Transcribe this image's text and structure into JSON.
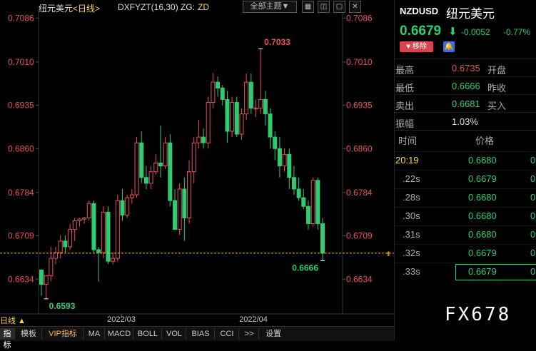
{
  "chart_header": {
    "title": "纽元美元",
    "period": "<日线>",
    "indicator": "DXFYZT(16,30)",
    "indicator_suffix": "ZG:",
    "indicator_value": "ZD",
    "theme_button": "全部主题▼",
    "icons": [
      "grid-icon",
      "split-icon",
      "fullscreen-icon",
      "close-icon"
    ]
  },
  "colors": {
    "up": "#e8505b",
    "down": "#2ecc71",
    "accent": "#ffd54a"
  },
  "chart_data": {
    "type": "candlestick",
    "symbol": "NZDUSD",
    "y_ticks": [
      "0.7086",
      "0.7010",
      "0.6935",
      "0.6860",
      "0.6784",
      "0.6709",
      "0.6634"
    ],
    "ylim": [
      0.658,
      0.71
    ],
    "x_ticks": [
      "2022/03",
      "2022/04"
    ],
    "annotations": {
      "high": "0.7033",
      "low": "0.6593",
      "last": "0.6666"
    },
    "reference_line": 0.6679,
    "candles": [
      {
        "o": 0.665,
        "h": 0.665,
        "l": 0.6605,
        "c": 0.6625
      },
      {
        "o": 0.6625,
        "h": 0.664,
        "l": 0.66,
        "c": 0.664
      },
      {
        "o": 0.664,
        "h": 0.669,
        "l": 0.663,
        "c": 0.667
      },
      {
        "o": 0.667,
        "h": 0.669,
        "l": 0.666,
        "c": 0.668
      },
      {
        "o": 0.668,
        "h": 0.671,
        "l": 0.667,
        "c": 0.67
      },
      {
        "o": 0.67,
        "h": 0.671,
        "l": 0.668,
        "c": 0.669
      },
      {
        "o": 0.669,
        "h": 0.673,
        "l": 0.6685,
        "c": 0.672
      },
      {
        "o": 0.672,
        "h": 0.674,
        "l": 0.67,
        "c": 0.6735
      },
      {
        "o": 0.6735,
        "h": 0.674,
        "l": 0.6725,
        "c": 0.6738
      },
      {
        "o": 0.6738,
        "h": 0.6742,
        "l": 0.673,
        "c": 0.674
      },
      {
        "o": 0.674,
        "h": 0.677,
        "l": 0.6735,
        "c": 0.6765
      },
      {
        "o": 0.6765,
        "h": 0.677,
        "l": 0.668,
        "c": 0.6685
      },
      {
        "o": 0.6685,
        "h": 0.669,
        "l": 0.663,
        "c": 0.668
      },
      {
        "o": 0.668,
        "h": 0.676,
        "l": 0.667,
        "c": 0.675
      },
      {
        "o": 0.675,
        "h": 0.676,
        "l": 0.666,
        "c": 0.6665
      },
      {
        "o": 0.6665,
        "h": 0.668,
        "l": 0.666,
        "c": 0.667
      },
      {
        "o": 0.667,
        "h": 0.678,
        "l": 0.6665,
        "c": 0.677
      },
      {
        "o": 0.677,
        "h": 0.679,
        "l": 0.6735,
        "c": 0.6745
      },
      {
        "o": 0.6745,
        "h": 0.678,
        "l": 0.674,
        "c": 0.6775
      },
      {
        "o": 0.6775,
        "h": 0.679,
        "l": 0.6765,
        "c": 0.678
      },
      {
        "o": 0.678,
        "h": 0.688,
        "l": 0.6775,
        "c": 0.687
      },
      {
        "o": 0.687,
        "h": 0.689,
        "l": 0.68,
        "c": 0.681
      },
      {
        "o": 0.681,
        "h": 0.683,
        "l": 0.679,
        "c": 0.68
      },
      {
        "o": 0.68,
        "h": 0.683,
        "l": 0.679,
        "c": 0.682
      },
      {
        "o": 0.682,
        "h": 0.685,
        "l": 0.6815,
        "c": 0.6835
      },
      {
        "o": 0.6835,
        "h": 0.69,
        "l": 0.681,
        "c": 0.683
      },
      {
        "o": 0.683,
        "h": 0.688,
        "l": 0.6825,
        "c": 0.687
      },
      {
        "o": 0.687,
        "h": 0.6885,
        "l": 0.676,
        "c": 0.677
      },
      {
        "o": 0.677,
        "h": 0.679,
        "l": 0.672,
        "c": 0.672
      },
      {
        "o": 0.672,
        "h": 0.68,
        "l": 0.671,
        "c": 0.679
      },
      {
        "o": 0.679,
        "h": 0.681,
        "l": 0.67,
        "c": 0.674
      },
      {
        "o": 0.674,
        "h": 0.684,
        "l": 0.673,
        "c": 0.682
      },
      {
        "o": 0.682,
        "h": 0.688,
        "l": 0.68,
        "c": 0.687
      },
      {
        "o": 0.687,
        "h": 0.691,
        "l": 0.686,
        "c": 0.688
      },
      {
        "o": 0.688,
        "h": 0.6895,
        "l": 0.686,
        "c": 0.687
      },
      {
        "o": 0.687,
        "h": 0.695,
        "l": 0.686,
        "c": 0.694
      },
      {
        "o": 0.694,
        "h": 0.699,
        "l": 0.693,
        "c": 0.6975
      },
      {
        "o": 0.6975,
        "h": 0.6985,
        "l": 0.695,
        "c": 0.6965
      },
      {
        "o": 0.6965,
        "h": 0.697,
        "l": 0.6935,
        "c": 0.6945
      },
      {
        "o": 0.6945,
        "h": 0.696,
        "l": 0.687,
        "c": 0.689
      },
      {
        "o": 0.689,
        "h": 0.695,
        "l": 0.688,
        "c": 0.694
      },
      {
        "o": 0.694,
        "h": 0.695,
        "l": 0.688,
        "c": 0.6885
      },
      {
        "o": 0.6885,
        "h": 0.693,
        "l": 0.6875,
        "c": 0.692
      },
      {
        "o": 0.692,
        "h": 0.699,
        "l": 0.691,
        "c": 0.6975
      },
      {
        "o": 0.6975,
        "h": 0.699,
        "l": 0.692,
        "c": 0.693
      },
      {
        "o": 0.693,
        "h": 0.6945,
        "l": 0.6915,
        "c": 0.693
      },
      {
        "o": 0.693,
        "h": 0.7033,
        "l": 0.692,
        "c": 0.6945
      },
      {
        "o": 0.6945,
        "h": 0.696,
        "l": 0.69,
        "c": 0.692
      },
      {
        "o": 0.692,
        "h": 0.693,
        "l": 0.686,
        "c": 0.688
      },
      {
        "o": 0.688,
        "h": 0.689,
        "l": 0.684,
        "c": 0.686
      },
      {
        "o": 0.686,
        "h": 0.688,
        "l": 0.681,
        "c": 0.683
      },
      {
        "o": 0.683,
        "h": 0.686,
        "l": 0.682,
        "c": 0.685
      },
      {
        "o": 0.685,
        "h": 0.686,
        "l": 0.679,
        "c": 0.681
      },
      {
        "o": 0.681,
        "h": 0.683,
        "l": 0.678,
        "c": 0.679
      },
      {
        "o": 0.679,
        "h": 0.681,
        "l": 0.677,
        "c": 0.6775
      },
      {
        "o": 0.6775,
        "h": 0.679,
        "l": 0.6755,
        "c": 0.676
      },
      {
        "o": 0.676,
        "h": 0.677,
        "l": 0.672,
        "c": 0.673
      },
      {
        "o": 0.673,
        "h": 0.681,
        "l": 0.6725,
        "c": 0.6805
      },
      {
        "o": 0.6805,
        "h": 0.681,
        "l": 0.672,
        "c": 0.673
      },
      {
        "o": 0.673,
        "h": 0.674,
        "l": 0.6666,
        "c": 0.6679
      }
    ]
  },
  "y_axis_right": [
    "0.7086",
    "0.7010",
    "0.6935",
    "0.6860",
    "0.6784",
    "0.6709",
    "0.6634"
  ],
  "bottom_bar": {
    "period_label": "日线 ▲",
    "tabs": [
      "指标",
      "模板",
      "VIP指标",
      "MA",
      "MACD",
      "BOLL",
      "VOL",
      "BIAS",
      "CCI",
      ">>",
      "设置"
    ]
  },
  "quote": {
    "symbol": "NZDUSD",
    "name": "纽元美元",
    "price": "0.6679",
    "arrow": "⬇",
    "change": "-0.0052",
    "change_pct": "-0.77%",
    "remove_label": "移除",
    "stats": [
      {
        "k": "最高",
        "v": "0.6735",
        "k2": "开盘",
        "color": "#e8505b"
      },
      {
        "k": "最低",
        "v": "0.6666",
        "k2": "昨收",
        "color": "#2ecc71"
      },
      {
        "k": "卖出",
        "v": "0.6681",
        "k2": "买入",
        "color": "#2ecc71"
      },
      {
        "k": "振幅",
        "v": "1.03%",
        "k2": "",
        "color": "#ddd"
      }
    ]
  },
  "ticks": {
    "head_time": "时间",
    "head_price": "价格",
    "rows": [
      {
        "t": "20:19",
        "p": "0.6680",
        "q": "0"
      },
      {
        "t": ".22s",
        "p": "0.6679",
        "q": "0"
      },
      {
        "t": ".28s",
        "p": "0.6680",
        "q": "0"
      },
      {
        "t": ".30s",
        "p": "0.6680",
        "q": "0"
      },
      {
        "t": ".31s",
        "p": "0.6680",
        "q": "0"
      },
      {
        "t": ".32s",
        "p": "0.6679",
        "q": "0"
      },
      {
        "t": ".33s",
        "p": "0.6679",
        "q": "0"
      }
    ]
  },
  "brand": "FX678"
}
